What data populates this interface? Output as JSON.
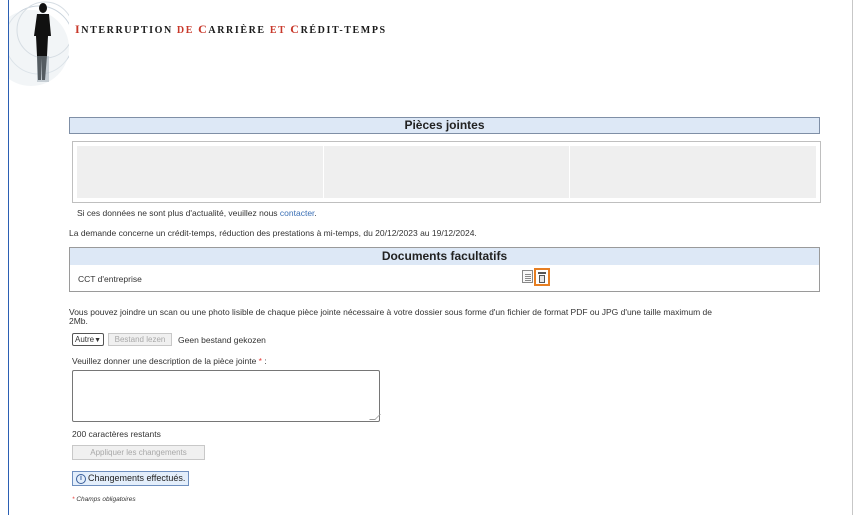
{
  "header": {
    "title_words": [
      {
        "cap": "I",
        "rest": "NTERRUPTION"
      },
      {
        "sep": "DE"
      },
      {
        "cap": "C",
        "rest": "ARRIÈRE"
      },
      {
        "sep": "ET"
      },
      {
        "cap": "C",
        "rest": "RÉDIT-TEMPS"
      }
    ]
  },
  "pieces_jointes": {
    "title": "Pièces jointes"
  },
  "info": {
    "stale_prefix": "Si ces données ne sont plus d'actualité, veuillez nous ",
    "stale_link": "contacter",
    "stale_suffix": ".",
    "request_summary": "La demande concerne un crédit-temps, réduction des prestations à mi-temps, du 20/12/2023 au 19/12/2024."
  },
  "documents": {
    "title": "Documents facultatifs",
    "rows": [
      {
        "label": "CCT d'entreprise"
      }
    ]
  },
  "upload": {
    "instructions_line1": "Vous pouvez joindre un scan ou une photo lisible de chaque pièce jointe nécessaire à votre dossier sous forme d'un fichier de format PDF ou JPG d'une taille maximum de",
    "instructions_line2": "2Mb.",
    "type_select_value": "Autre",
    "file_button_label": "Bestand lezen",
    "file_status": "Geen bestand gekozen",
    "description_label": "Veuillez donner une description de la pièce jointe",
    "required_marker": "*",
    "description_colon": " :",
    "description_value": "",
    "remaining_chars": "200 caractères restants",
    "apply_button_label": "Appliquer les changements"
  },
  "notice": {
    "text": "Changements effectués."
  },
  "footer": {
    "required_note_marker": "*",
    "required_note": " Champs obligatoires"
  }
}
